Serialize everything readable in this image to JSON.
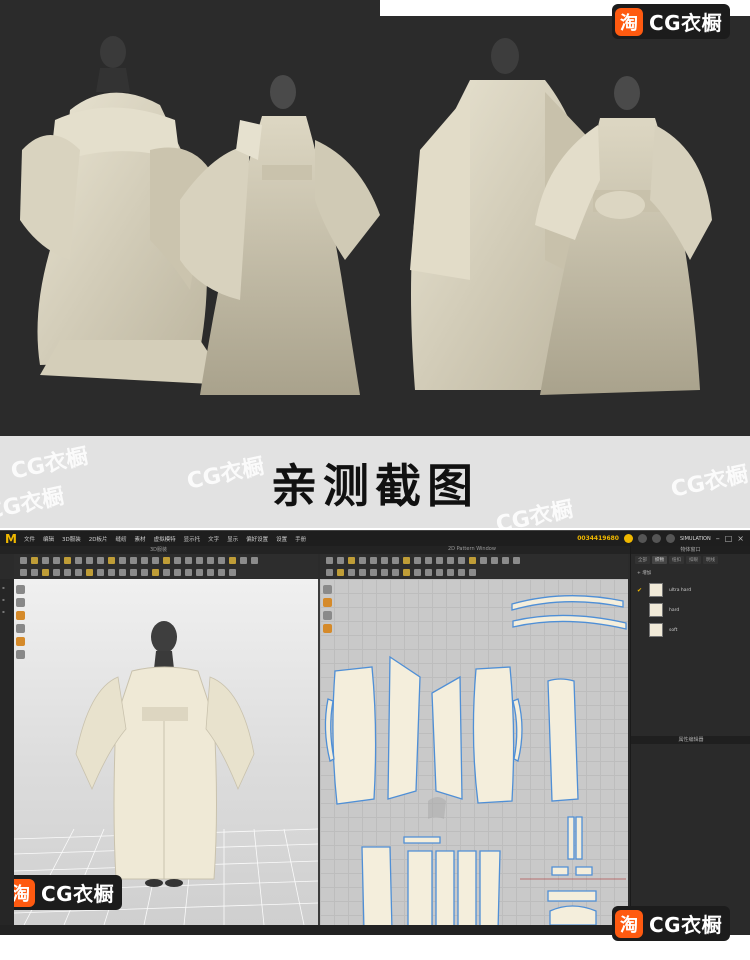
{
  "brand": {
    "logo_char": "淘",
    "name": "CG衣橱",
    "accent": "#ff5a10"
  },
  "banner": {
    "title": "亲测截图",
    "watermark": "CG衣橱"
  },
  "app": {
    "logo": "M",
    "menu": [
      "文件",
      "编辑",
      "3D服装",
      "2D板片",
      "缝纫",
      "素材",
      "虚拟模特",
      "显示托",
      "文字",
      "显示",
      "偏好设置",
      "设置",
      "手册"
    ],
    "id_text": "0034419680",
    "mode_label": "SIMULATION",
    "panel_3d_title": "3D服装",
    "panel_2d_title": "2D Pattern Window",
    "right_panel": {
      "title": "物体窗口",
      "tabs": [
        "全部",
        "织物",
        "纽扣",
        "扣眼",
        "明线"
      ],
      "add_label": "+ 增加",
      "fabrics": [
        "ultra hard",
        "hard",
        "soft"
      ],
      "editor_title": "属性编辑器"
    },
    "colors": {
      "fabric": "#f1ead8",
      "outline": "#4f8fd6",
      "accent": "#f0b800"
    }
  },
  "icons": [
    "app-logo-icon",
    "minimize-icon",
    "maximize-icon",
    "close-icon",
    "check-icon"
  ]
}
